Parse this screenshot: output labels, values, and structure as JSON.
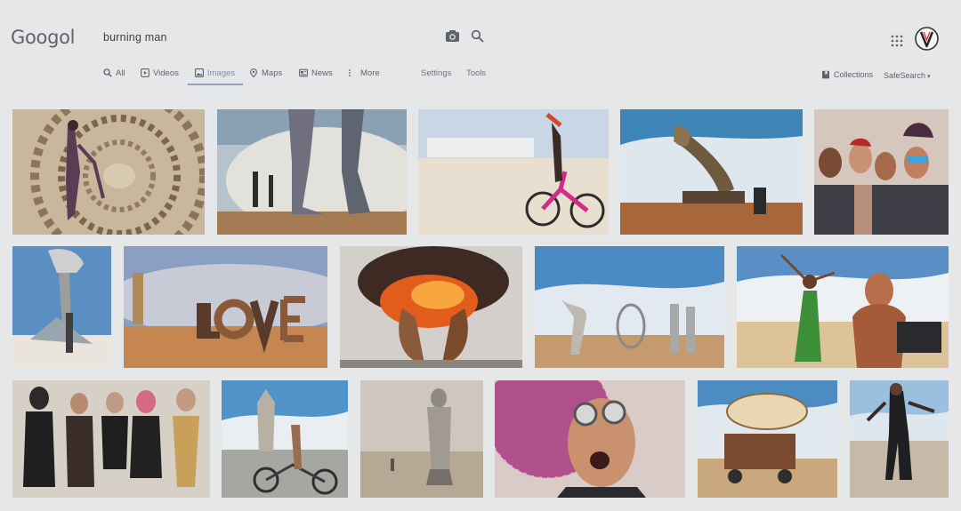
{
  "header": {
    "logo": "Googol",
    "query": "burning man",
    "icons": [
      "camera-icon",
      "search-icon",
      "apps-icon",
      "account-avatar"
    ]
  },
  "tabs": [
    {
      "label": "All",
      "icon": "search-icon",
      "active": false
    },
    {
      "label": "Videos",
      "icon": "play-icon",
      "active": false
    },
    {
      "label": "Images",
      "icon": "image-icon",
      "active": true
    },
    {
      "label": "Maps",
      "icon": "pin-icon",
      "active": false
    },
    {
      "label": "News",
      "icon": "news-icon",
      "active": false
    },
    {
      "label": "More",
      "icon": "more-icon",
      "active": false
    }
  ],
  "tools": {
    "settings": "Settings",
    "tools": "Tools"
  },
  "right_tools": {
    "collections": "Collections",
    "safesearch": "SafeSearch"
  },
  "colors": {
    "background": "#e6e7e9",
    "active_tab": "#1a73e8",
    "text": "#5f6368"
  }
}
